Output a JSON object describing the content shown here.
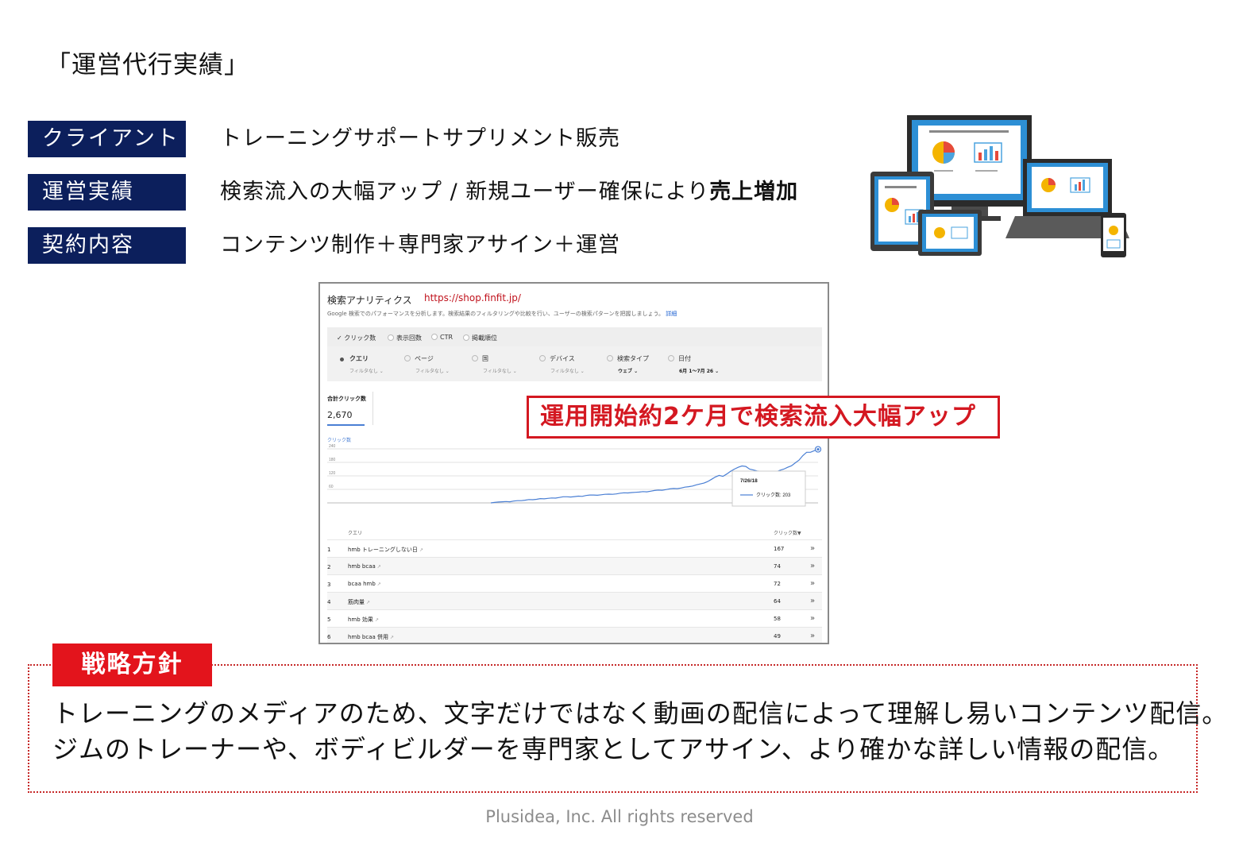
{
  "title": "「運営代行実績」",
  "rows": [
    {
      "label": "クライアント",
      "text": "トレーニングサポートサプリメント販売"
    },
    {
      "label": "運営実績",
      "text": "検索流入の大幅アップ / 新規ユーザー確保により",
      "bold": "売上増加"
    },
    {
      "label": "契約内容",
      "text": "コンテンツ制作＋専門家アサイン＋運営"
    }
  ],
  "devices": {
    "icon": "devices-illustration-icon"
  },
  "panel": {
    "heading": "検索アナリティクス",
    "url": "https://shop.finfit.jp/",
    "description": "Google 検索でのパフォーマンスを分析します。検索結果のフィルタリングや比較を行い、ユーザーの検索パターンを把握しましょう。",
    "description_link": "詳細",
    "metrics": [
      "✓ クリック数",
      "表示回数",
      "CTR",
      "掲載順位"
    ],
    "filters": [
      {
        "label": "クエリ",
        "sub": "フィルタなし ⌄"
      },
      {
        "label": "ページ",
        "sub": "フィルタなし ⌄"
      },
      {
        "label": "国",
        "sub": "フィルタなし ⌄"
      },
      {
        "label": "デバイス",
        "sub": "フィルタなし ⌄"
      },
      {
        "label": "検索タイプ",
        "sub": "ウェブ ⌄"
      },
      {
        "label": "日付",
        "sub": "6月 1〜7月 26 ⌄"
      }
    ],
    "total_label": "合計クリック数",
    "total_value": "2,670",
    "chart_label": "クリック数",
    "tooltip_date": "7/26/18",
    "tooltip_value": "クリック数: 203",
    "table_headers": {
      "query": "クエリ",
      "clicks": "クリック数▼"
    },
    "table_rows": [
      {
        "n": "1",
        "q": "hmb トレーニングしない日",
        "v": "167"
      },
      {
        "n": "2",
        "q": "hmb bcaa",
        "v": "74"
      },
      {
        "n": "3",
        "q": "bcaa hmb",
        "v": "72"
      },
      {
        "n": "4",
        "q": "筋肉量",
        "v": "64"
      },
      {
        "n": "5",
        "q": "hmb 効果",
        "v": "58"
      },
      {
        "n": "6",
        "q": "hmb bcaa 併用",
        "v": "49"
      }
    ]
  },
  "chart_data": {
    "type": "line",
    "yticks": [
      "240",
      "180",
      "120",
      "60"
    ],
    "ylim": [
      0,
      240
    ],
    "series": [
      {
        "values": [
          0,
          2,
          4,
          5,
          6,
          5,
          8,
          10,
          10,
          12,
          15,
          14,
          16,
          19,
          18,
          20,
          22,
          21,
          24,
          27,
          27,
          26,
          28,
          30,
          29,
          33,
          35,
          35,
          34,
          36,
          38,
          39,
          38,
          40,
          43,
          45,
          44,
          46,
          47,
          48,
          50,
          49,
          52,
          55,
          57,
          56,
          59,
          62,
          64,
          63,
          66,
          70,
          72,
          75,
          80,
          84,
          88,
          95,
          105,
          115,
          122,
          118,
          128,
          140,
          150,
          158,
          164,
          162,
          150,
          146,
          142,
          140,
          138,
          136,
          140,
          138,
          145,
          150,
          158,
          165,
          178,
          190,
          210,
          225,
          225,
          232,
          238
        ]
      }
    ]
  },
  "callout": "運用開始約2ケ月で検索流入大幅アップ",
  "strategy": {
    "tag": "戦略方針",
    "lines": [
      "トレーニングのメディアのため、文字だけではなく動画の配信によって理解し易いコンテンツ配信。",
      "ジムのトレーナーや、ボディビルダーを専門家としてアサイン、より確かな詳しい情報の配信。"
    ]
  },
  "footer": "Plusidea, Inc. All rights reserved"
}
